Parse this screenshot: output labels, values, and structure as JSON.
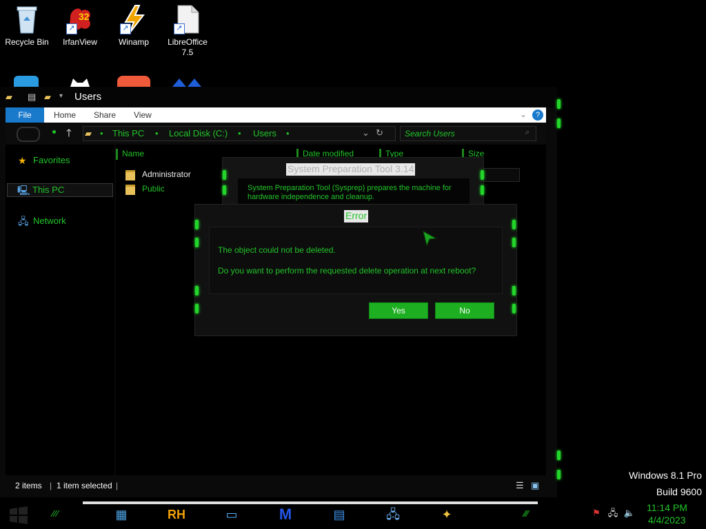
{
  "desktop": {
    "icons": [
      {
        "label": "Recycle Bin",
        "icon": "recycle-bin-icon"
      },
      {
        "label": "IrfanView",
        "icon": "irfanview-icon",
        "badge": "32"
      },
      {
        "label": "Winamp",
        "icon": "winamp-icon"
      },
      {
        "label": "LibreOffice\n7.5",
        "label_line1": "LibreOffice",
        "label_line2": "7.5",
        "icon": "libreoffice-icon"
      }
    ]
  },
  "explorer": {
    "title": "Users",
    "ribbon": {
      "file": "File",
      "home": "Home",
      "share": "Share",
      "view": "View",
      "help": "?"
    },
    "address": {
      "crumbs": [
        "This PC",
        "Local Disk (C:)",
        "Users"
      ]
    },
    "search": {
      "placeholder": "Search Users"
    },
    "nav": {
      "favorites": "Favorites",
      "this_pc": "This PC",
      "network": "Network"
    },
    "columns": {
      "name": "Name",
      "date": "Date modified",
      "type": "Type",
      "size": "Size"
    },
    "items": [
      {
        "name": "Administrator"
      },
      {
        "name": "Public"
      }
    ],
    "status": {
      "items": "2 items",
      "selected": "1 item selected"
    }
  },
  "sysprep_dialog": {
    "title": "System Preparation Tool 3.14",
    "description_line1": "System Preparation Tool (Sysprep) prepares the machine for",
    "description_line2": "hardware independence and cleanup."
  },
  "error_dialog": {
    "title": "Error",
    "message": "The object could not be deleted.",
    "question": "Do you want to perform the requested delete operation at next reboot?",
    "yes": "Yes",
    "no": "No"
  },
  "watermark": {
    "line1": "Windows 8.1 Pro",
    "line2": "Build 9600"
  },
  "taskbar": {
    "clock_time": "11:14 PM",
    "clock_date": "4/4/2023",
    "pinned": [
      "control-panel-icon",
      "rh-icon",
      "window-icon",
      "malwarebytes-icon",
      "document-icon",
      "network-icon",
      "wand-icon"
    ],
    "rh_label": "RH"
  },
  "colors": {
    "accent_green": "#22c52a",
    "button_green": "#1dae21",
    "ribbon_file": "#1979ca"
  }
}
